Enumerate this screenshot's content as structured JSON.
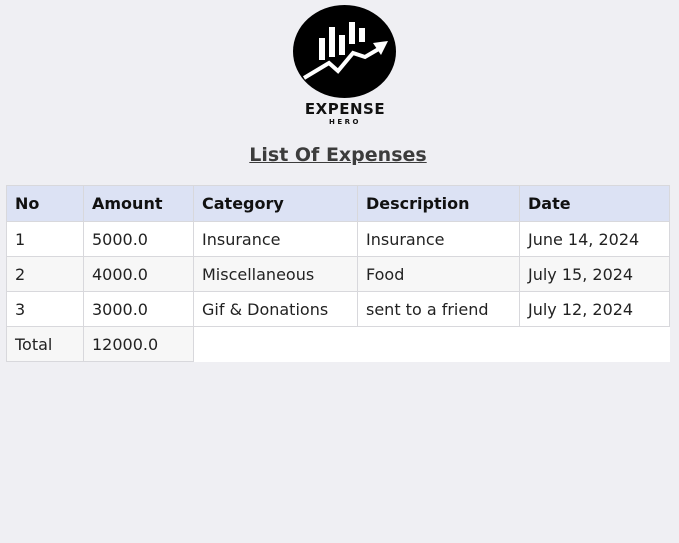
{
  "brand": {
    "name": "EXPENSE",
    "tagline": "HERO",
    "logo_icon": "rising-bar-chart-icon",
    "logo_color": "#000000"
  },
  "page": {
    "title": "List Of Expenses"
  },
  "table": {
    "headers": [
      "No",
      "Amount",
      "Category",
      "Description",
      "Date"
    ],
    "rows": [
      {
        "no": "1",
        "amount": "5000.0",
        "category": "Insurance",
        "description": "Insurance",
        "date": "June 14, 2024"
      },
      {
        "no": "2",
        "amount": "4000.0",
        "category": "Miscellaneous",
        "description": "Food",
        "date": "July 15, 2024"
      },
      {
        "no": "3",
        "amount": "3000.0",
        "category": "Gif & Donations",
        "description": "sent to a friend",
        "date": "July 12, 2024"
      }
    ],
    "total_label": "Total",
    "total_value": "12000.0"
  },
  "colors": {
    "header_bg": "#dce2f4",
    "page_bg": "#efeff3"
  }
}
